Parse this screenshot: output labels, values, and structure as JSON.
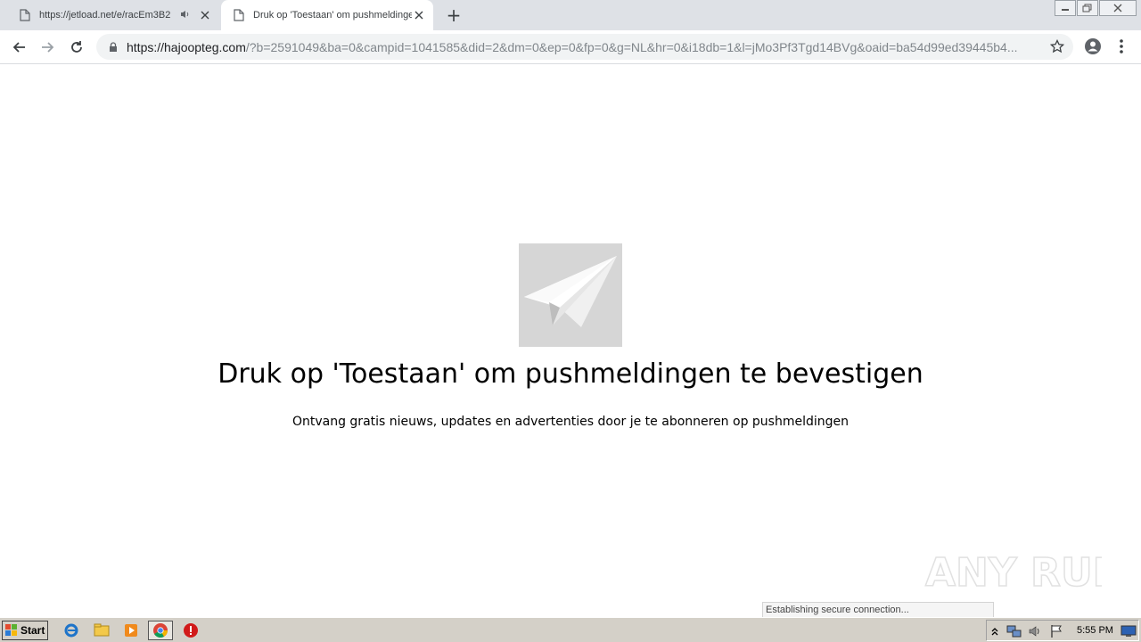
{
  "browser": {
    "tabs": [
      {
        "title": "https://jetload.net/e/racEm3B2",
        "audio": true,
        "active": false
      },
      {
        "title": "Druk op 'Toestaan' om pushmeldingen",
        "audio": false,
        "active": true
      }
    ],
    "new_tab_symbol": "+",
    "url_host": "https://hajoopteg.com",
    "url_rest": "/?b=2591049&ba=0&campid=1041585&did=2&dm=0&ep=0&fp=0&g=NL&hr=0&i18db=1&l=jMo3Pf3Tgd14BVg&oaid=ba54d99ed39445b4..."
  },
  "page": {
    "headline": "Druk op 'Toestaan' om pushmeldingen te bevestigen",
    "subline": "Ontvang gratis nieuws, updates en advertenties door je te abonneren op pushmeldingen",
    "status_text": "Establishing secure connection...",
    "watermark": "ANY RUN"
  },
  "taskbar": {
    "start_label": "Start",
    "clock": "5:55 PM"
  },
  "icons": {
    "tab_favicon": "document-icon",
    "back": "back-arrow-icon",
    "forward": "forward-arrow-icon",
    "reload": "reload-icon",
    "lock": "lock-icon",
    "bookmark": "star-icon",
    "profile": "account-circle-icon",
    "menu": "kebab-menu-icon",
    "hero": "paper-plane-icon"
  },
  "colors": {
    "tabstrip": "#dee1e6",
    "omnibox": "#f1f3f4",
    "hero_box": "#d6d6d6",
    "taskbar": "#d4d0c8"
  }
}
